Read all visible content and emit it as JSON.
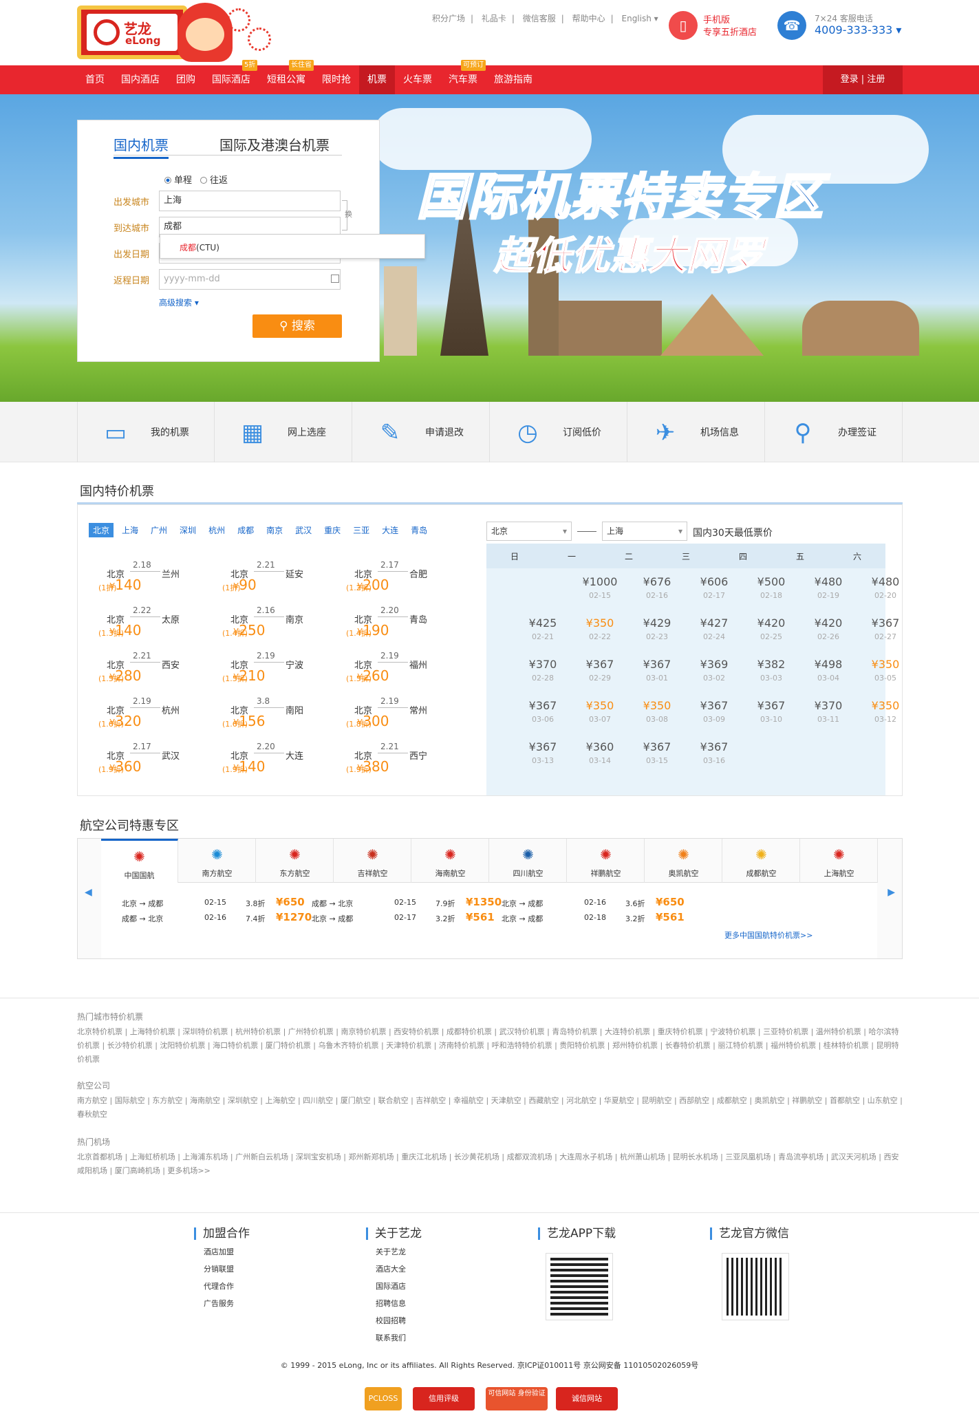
{
  "header": {
    "logo_cn": "艺龙",
    "logo_en": "eLong",
    "top_links": [
      "积分广场",
      "礼品卡",
      "微信客服",
      "帮助中心",
      "English"
    ],
    "mobile_title": "手机版",
    "mobile_sub": "专享五折酒店",
    "hotline_label": "7×24 客服电话",
    "hotline_number": "4009-333-333"
  },
  "nav": {
    "items": [
      "首页",
      "国内酒店",
      "团购",
      "国际酒店",
      "短租公寓",
      "限时抢",
      "机票",
      "火车票",
      "汽车票",
      "旅游指南"
    ],
    "badges": [
      "5折",
      "长住省",
      "可预订"
    ],
    "login": "登录 | 注册"
  },
  "banner": {
    "title": "国际机票特卖专区",
    "subtitle": "超低优惠大网罗"
  },
  "search": {
    "tab_domestic": "国内机票",
    "tab_intl": "国际及港澳台机票",
    "oneway": "单程",
    "roundtrip": "往返",
    "from_label": "出发城市",
    "to_label": "到达城市",
    "depart_label": "出发日期",
    "return_label": "返程日期",
    "from_value": "上海",
    "to_value": "成都",
    "return_placeholder": "yyyy-mm-dd",
    "swap": "换",
    "suggest_hl": "成都",
    "suggest_rest": "(CTU)",
    "advanced": "高级搜索",
    "button": "搜索"
  },
  "quick": [
    "我的机票",
    "网上选座",
    "申请退改",
    "订阅低价",
    "机场信息",
    "办理签证"
  ],
  "deals": {
    "title": "国内特价机票",
    "cities": [
      "北京",
      "上海",
      "广州",
      "深圳",
      "杭州",
      "成都",
      "南京",
      "武汉",
      "重庆",
      "三亚",
      "大连",
      "青岛"
    ],
    "items": [
      {
        "from": "北京",
        "to": "兰州",
        "date": "2.18",
        "price": "140",
        "discount": "(1折)"
      },
      {
        "from": "北京",
        "to": "延安",
        "date": "2.21",
        "price": "90",
        "discount": "(1折)"
      },
      {
        "from": "北京",
        "to": "合肥",
        "date": "2.17",
        "price": "200",
        "discount": "(1.2折)"
      },
      {
        "from": "北京",
        "to": "太原",
        "date": "2.22",
        "price": "140",
        "discount": "(1.3折)"
      },
      {
        "from": "北京",
        "to": "南京",
        "date": "2.16",
        "price": "250",
        "discount": "(1.4折)"
      },
      {
        "from": "北京",
        "to": "青岛",
        "date": "2.20",
        "price": "190",
        "discount": "(1.4折)"
      },
      {
        "from": "北京",
        "to": "西安",
        "date": "2.21",
        "price": "280",
        "discount": "(1.5折)"
      },
      {
        "from": "北京",
        "to": "宁波",
        "date": "2.19",
        "price": "210",
        "discount": "(1.5折)"
      },
      {
        "from": "北京",
        "to": "福州",
        "date": "2.19",
        "price": "260",
        "discount": "(1.5折)"
      },
      {
        "from": "北京",
        "to": "杭州",
        "date": "2.19",
        "price": "320",
        "discount": "(1.6折)"
      },
      {
        "from": "北京",
        "to": "南阳",
        "date": "3.8",
        "price": "156",
        "discount": "(1.6折)"
      },
      {
        "from": "北京",
        "to": "常州",
        "date": "2.19",
        "price": "300",
        "discount": "(1.8折)"
      },
      {
        "from": "北京",
        "to": "武汉",
        "date": "2.17",
        "price": "360",
        "discount": "(1.9折)"
      },
      {
        "from": "北京",
        "to": "大连",
        "date": "2.20",
        "price": "140",
        "discount": "(1.9折)"
      },
      {
        "from": "北京",
        "to": "西宁",
        "date": "2.21",
        "price": "380",
        "discount": "(1.9折)"
      }
    ],
    "cal_from": "北京",
    "cal_to": "上海",
    "cal_title": "国内30天最低票价",
    "weekdays": [
      "日",
      "一",
      "二",
      "三",
      "四",
      "五",
      "六"
    ],
    "calendar": [
      {
        "col": 1,
        "row": 0,
        "p": "¥1000",
        "d": "02-15"
      },
      {
        "col": 2,
        "row": 0,
        "p": "¥676",
        "d": "02-16"
      },
      {
        "col": 3,
        "row": 0,
        "p": "¥606",
        "d": "02-17"
      },
      {
        "col": 4,
        "row": 0,
        "p": "¥500",
        "d": "02-18"
      },
      {
        "col": 5,
        "row": 0,
        "p": "¥480",
        "d": "02-19"
      },
      {
        "col": 6,
        "row": 0,
        "p": "¥480",
        "d": "02-20"
      },
      {
        "col": 0,
        "row": 1,
        "p": "¥425",
        "d": "02-21"
      },
      {
        "col": 1,
        "row": 1,
        "p": "¥350",
        "d": "02-22",
        "hl": true
      },
      {
        "col": 2,
        "row": 1,
        "p": "¥429",
        "d": "02-23"
      },
      {
        "col": 3,
        "row": 1,
        "p": "¥427",
        "d": "02-24"
      },
      {
        "col": 4,
        "row": 1,
        "p": "¥420",
        "d": "02-25"
      },
      {
        "col": 5,
        "row": 1,
        "p": "¥420",
        "d": "02-26"
      },
      {
        "col": 6,
        "row": 1,
        "p": "¥367",
        "d": "02-27"
      },
      {
        "col": 0,
        "row": 2,
        "p": "¥370",
        "d": "02-28"
      },
      {
        "col": 1,
        "row": 2,
        "p": "¥367",
        "d": "02-29"
      },
      {
        "col": 2,
        "row": 2,
        "p": "¥367",
        "d": "03-01"
      },
      {
        "col": 3,
        "row": 2,
        "p": "¥369",
        "d": "03-02"
      },
      {
        "col": 4,
        "row": 2,
        "p": "¥382",
        "d": "03-03"
      },
      {
        "col": 5,
        "row": 2,
        "p": "¥498",
        "d": "03-04"
      },
      {
        "col": 6,
        "row": 2,
        "p": "¥350",
        "d": "03-05",
        "hl": true
      },
      {
        "col": 0,
        "row": 3,
        "p": "¥367",
        "d": "03-06"
      },
      {
        "col": 1,
        "row": 3,
        "p": "¥350",
        "d": "03-07",
        "hl": true
      },
      {
        "col": 2,
        "row": 3,
        "p": "¥350",
        "d": "03-08",
        "hl": true
      },
      {
        "col": 3,
        "row": 3,
        "p": "¥367",
        "d": "03-09"
      },
      {
        "col": 4,
        "row": 3,
        "p": "¥367",
        "d": "03-10"
      },
      {
        "col": 5,
        "row": 3,
        "p": "¥370",
        "d": "03-11"
      },
      {
        "col": 6,
        "row": 3,
        "p": "¥350",
        "d": "03-12",
        "hl": true
      },
      {
        "col": 0,
        "row": 4,
        "p": "¥367",
        "d": "03-13"
      },
      {
        "col": 1,
        "row": 4,
        "p": "¥360",
        "d": "03-14"
      },
      {
        "col": 2,
        "row": 4,
        "p": "¥367",
        "d": "03-15"
      },
      {
        "col": 3,
        "row": 4,
        "p": "¥367",
        "d": "03-16"
      }
    ]
  },
  "airlines": {
    "title": "航空公司特惠专区",
    "tabs": [
      {
        "name": "中国国航",
        "color": "#d8251e"
      },
      {
        "name": "南方航空",
        "color": "#1a8bd6"
      },
      {
        "name": "东方航空",
        "color": "#d8251e"
      },
      {
        "name": "吉祥航空",
        "color": "#c8301e"
      },
      {
        "name": "海南航空",
        "color": "#d8251e"
      },
      {
        "name": "四川航空",
        "color": "#1a5ea8"
      },
      {
        "name": "祥鹏航空",
        "color": "#d8251e"
      },
      {
        "name": "奥凯航空",
        "color": "#f0801a"
      },
      {
        "name": "成都航空",
        "color": "#f0b01a"
      },
      {
        "name": "上海航空",
        "color": "#d8251e"
      }
    ],
    "flights": [
      {
        "route": "北京 → 成都",
        "date": "02-15",
        "disc": "3.8折",
        "price": "¥650"
      },
      {
        "route": "成都 → 北京",
        "date": "02-16",
        "disc": "7.4折",
        "price": "¥1270"
      },
      {
        "route": "成都 → 北京",
        "date": "02-15",
        "disc": "7.9折",
        "price": "¥1350"
      },
      {
        "route": "北京 → 成都",
        "date": "02-17",
        "disc": "3.2折",
        "price": "¥561"
      },
      {
        "route": "北京 → 成都",
        "date": "02-16",
        "disc": "3.6折",
        "price": "¥650"
      },
      {
        "route": "北京 → 成都",
        "date": "02-18",
        "disc": "3.2折",
        "price": "¥561"
      }
    ],
    "more": "更多中国国航特价机票>>"
  },
  "seo": {
    "cities_title": "热门城市特价机票",
    "cities": "北京特价机票 | 上海特价机票 | 深圳特价机票 | 杭州特价机票 | 广州特价机票 | 南京特价机票 | 西安特价机票 | 成都特价机票 | 武汉特价机票 | 青岛特价机票 | 大连特价机票 | 重庆特价机票 | 宁波特价机票 | 三亚特价机票 | 温州特价机票 | 哈尔滨特价机票 | 长沙特价机票 | 沈阳特价机票 | 海口特价机票 | 厦门特价机票 | 乌鲁木齐特价机票 | 天津特价机票 | 济南特价机票 | 呼和浩特特价机票 | 贵阳特价机票 | 郑州特价机票 | 长春特价机票 | 丽江特价机票 | 福州特价机票 | 桂林特价机票 | 昆明特价机票",
    "airlines_title": "航空公司",
    "airlines": "南方航空 | 国际航空 | 东方航空 | 海南航空 | 深圳航空 | 上海航空 | 四川航空 | 厦门航空 | 联合航空 | 吉祥航空 | 幸福航空 | 天津航空 | 西藏航空 | 河北航空 | 华夏航空 | 昆明航空 | 西部航空 | 成都航空 | 奥凯航空 | 祥鹏航空 | 首都航空 | 山东航空 | 春秋航空",
    "airports_title": "热门机场",
    "airports": "北京首都机场 | 上海虹桥机场 | 上海浦东机场 | 广州新白云机场 | 深圳宝安机场 | 郑州新郑机场 | 重庆江北机场 | 长沙黄花机场 | 成都双流机场 | 大连周水子机场 | 杭州萧山机场 | 昆明长水机场 | 三亚凤凰机场 | 青岛流亭机场 | 武汉天河机场 | 西安咸阳机场 | 厦门高崎机场 | 更多机场>>"
  },
  "footer": {
    "col1_title": "加盟合作",
    "col1": [
      "酒店加盟",
      "分销联盟",
      "代理合作",
      "广告服务"
    ],
    "col2_title": "关于艺龙",
    "col2": [
      "关于艺龙",
      "酒店大全",
      "国际酒店",
      "招聘信息",
      "校园招聘",
      "联系我们"
    ],
    "col3_title": "艺龙APP下载",
    "col4_title": "艺龙官方微信",
    "copyright": "© 1999 - 2015 eLong, Inc or its affiliates. All Rights Reserved. 京ICP证010011号 京公网安备 11010502026059号",
    "badges": [
      "PCLOSS",
      "信用评级",
      "可信网站 身份验证",
      "诚信网站"
    ]
  }
}
